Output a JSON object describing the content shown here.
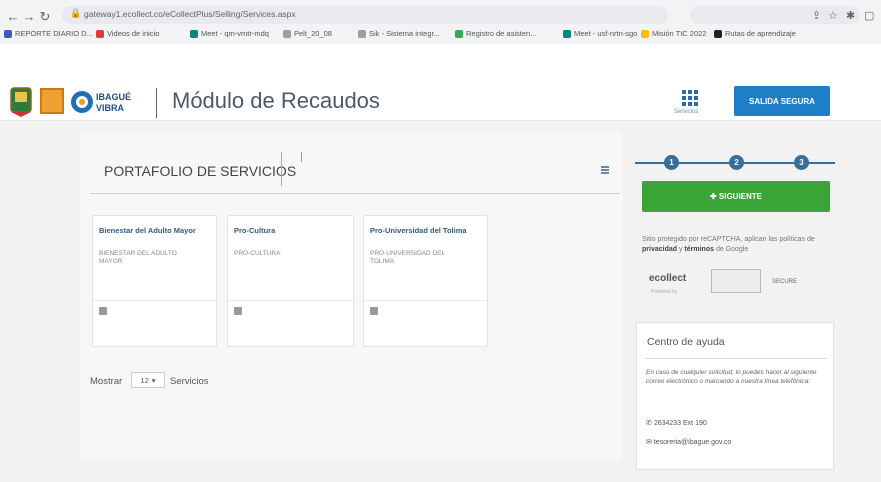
{
  "browser": {
    "url": "gateway1.ecollect.co/eCollectPlus/Selling/Services.aspx",
    "bookmarks": [
      {
        "label": "REPORTE DIARIO D...",
        "color": "#3b5db5"
      },
      {
        "label": "Videos de inicio",
        "color": "#e53935"
      },
      {
        "label": "Meet - qm-vmtr-mdq",
        "color": "#00897b"
      },
      {
        "label": "Pelt_20_08",
        "color": "#9e9e9e"
      },
      {
        "label": "Sik - Sistema integr...",
        "color": "#9e9e9e"
      },
      {
        "label": "Registro de asisten...",
        "color": "#34a853"
      },
      {
        "label": "Meet - usf-nrtn-sgo",
        "color": "#00897b"
      },
      {
        "label": "Misión TIC 2022",
        "color": "#fbbc04"
      },
      {
        "label": "Rutas de aprendizaje",
        "color": "#202124"
      }
    ]
  },
  "header": {
    "title": "Módulo de Recaudos",
    "logo_text_1": "IBAGUÉ",
    "logo_text_2": "VIBRA",
    "servicios_label": "Servicios",
    "salida_label": "SALIDA SEGURA"
  },
  "portfolio": {
    "title": "PORTAFOLIO DE SERVICIOS",
    "cards": [
      {
        "title": "Bienestar del Adulto Mayor",
        "desc": "BIENESTAR DEL ADULTO MAYOR"
      },
      {
        "title": "Pro-Cultura",
        "desc": "PRO-CULTURA"
      },
      {
        "title": "Pro-Universidad del Tolima",
        "desc": "PRO-UNIVERSIDAD DEL TOLIMA"
      }
    ],
    "mostrar_label": "Mostrar",
    "mostrar_value": "12",
    "servicios_word": "Servicios"
  },
  "stepper": {
    "steps": [
      "1",
      "2",
      "3"
    ],
    "current": 1
  },
  "siguiente_label": "✚ SIGUIENTE",
  "recaptcha": {
    "text_pre": "Sitio protegido por reCAPTCHA, aplican las políticas de",
    "privacy": "privacidad",
    "and": "y",
    "terms": "términos",
    "text_post": "de Google",
    "ecollect": "ecollect",
    "ecollect_sub": "Powered by",
    "secure": "SECURE"
  },
  "help": {
    "title": "Centro de ayuda",
    "text": "En caso de cualquier solicitud, lo puedes hacer al siguiente correo electrónico o marcando a nuestra línea telefónica:",
    "phone": "2634233 Ext 190",
    "email": "tesoreria@ibague.gov.co"
  },
  "colors": {
    "accent_blue": "#1e7fc8",
    "step_blue": "#3a6e96",
    "green": "#3aa536"
  }
}
